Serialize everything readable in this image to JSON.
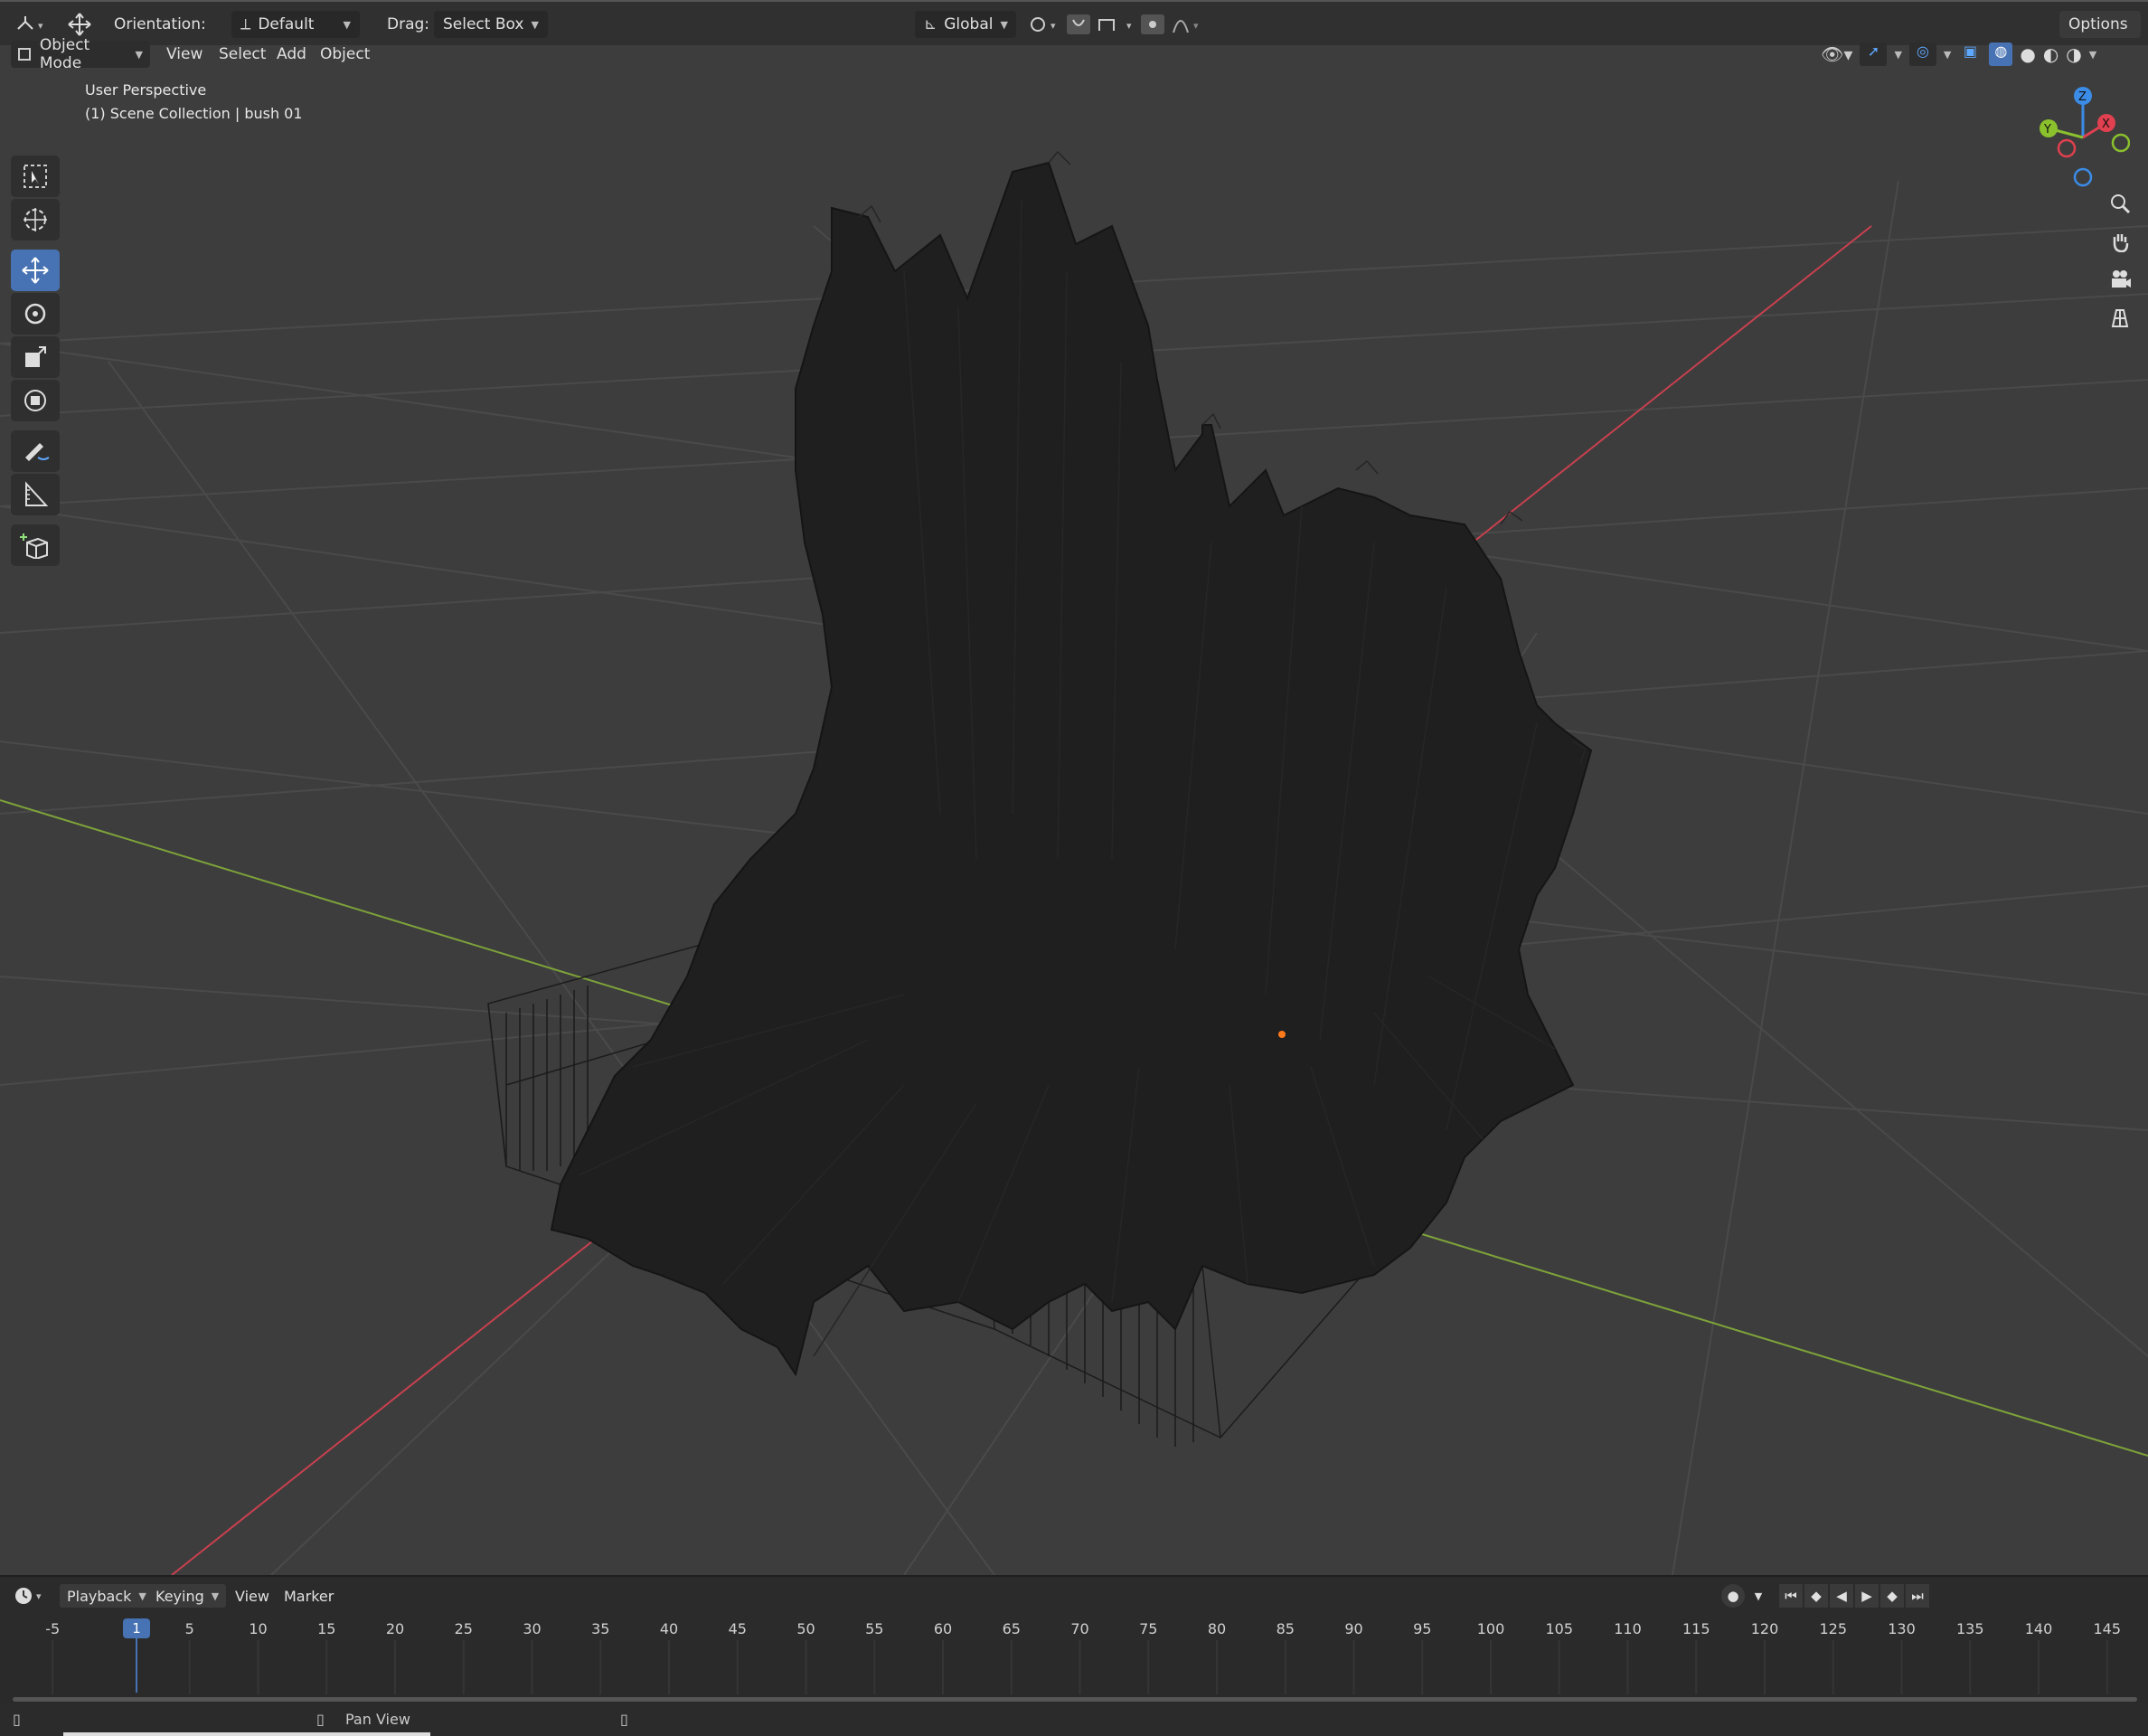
{
  "topbar": {
    "orientation_label": "Orientation:",
    "orientation_value": "Default",
    "drag_label": "Drag:",
    "drag_value": "Select Box",
    "transform_orientation": "Global",
    "options_label": "Options"
  },
  "header": {
    "mode": "Object Mode",
    "menus": [
      "View",
      "Select",
      "Add",
      "Object"
    ]
  },
  "viewport": {
    "perspective_label": "User Perspective",
    "collection_label": "(1) Scene Collection | bush 01"
  },
  "gizmo": {
    "axes": [
      "X",
      "Y",
      "Z"
    ],
    "colors": {
      "x": "#e0404f",
      "y": "#8bc12d",
      "z": "#3b8ce6"
    }
  },
  "timeline": {
    "menus": [
      "Playback",
      "Keying",
      "View",
      "Marker"
    ],
    "current_frame": "1",
    "ticks": [
      "-5",
      "5",
      "10",
      "15",
      "20",
      "25",
      "30",
      "35",
      "40",
      "45",
      "50",
      "55",
      "60",
      "65",
      "70",
      "75",
      "80",
      "85",
      "90",
      "95",
      "100",
      "105",
      "110",
      "115",
      "120",
      "125",
      "130",
      "135",
      "140",
      "145"
    ]
  },
  "statusbar": {
    "pan_view_label": "Pan View"
  },
  "colors": {
    "accent": "#4772b3",
    "x_axis": "#c8404f",
    "y_axis": "#7ea33a",
    "viewport_bg": "#3d3d3d"
  }
}
